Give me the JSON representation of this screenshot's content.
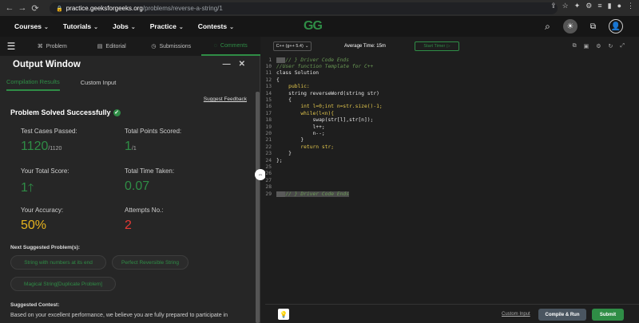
{
  "browser": {
    "url_host": "practice.geeksforgeeks.org",
    "url_path": "/problems/reverse-a-string/1"
  },
  "site_nav": {
    "logo": "GG",
    "menu": [
      "Courses",
      "Tutorials",
      "Jobs",
      "Practice",
      "Contests"
    ]
  },
  "tabs": {
    "problem": "Problem",
    "editorial": "Editorial",
    "submissions": "Submissions",
    "comments": "Comments"
  },
  "output_window": {
    "title": "Output Window",
    "tab_results": "Compilation Results",
    "tab_custom": "Custom Input",
    "suggest_feedback": "Suggest Feedback",
    "status": "Problem Solved Successfully",
    "stats": {
      "test_cases_label": "Test Cases Passed:",
      "test_cases_value": "1120",
      "test_cases_total": "/1120",
      "points_label": "Total Points Scored:",
      "points_value": "1",
      "points_total": "/1",
      "score_label": "Your Total Score:",
      "score_value": "1",
      "time_label": "Total Time Taken:",
      "time_value": "0.07",
      "accuracy_label": "Your Accuracy:",
      "accuracy_value": "50%",
      "attempts_label": "Attempts No.:",
      "attempts_value": "2"
    },
    "next_suggested_title": "Next Suggested Problem(s):",
    "suggestions": [
      "String with numbers at its end",
      "Perfect Reversible String",
      "Magical String[Duplicate Problem]"
    ],
    "contest_title": "Suggested Contest:",
    "contest_text": "Based on your excellent performance, we believe you are fully prepared to participate in"
  },
  "editor_toolbar": {
    "language": "C++ (g++ 5.4)",
    "avg_time": "Average Time: 15m",
    "start_timer": "Start Timer"
  },
  "code_lines": [
    {
      "n": "1",
      "text": "// } Driver Code Ends"
    },
    {
      "n": "10",
      "text": "//User function Template for C++"
    },
    {
      "n": "11",
      "text": "class Solution"
    },
    {
      "n": "12",
      "text": "{"
    },
    {
      "n": "13",
      "text": "    public:"
    },
    {
      "n": "14",
      "text": "    string reverseWord(string str)"
    },
    {
      "n": "15",
      "text": "    {"
    },
    {
      "n": "16",
      "text": "        int l=0;int n=str.size()-1;"
    },
    {
      "n": "17",
      "text": "        while(l<n){"
    },
    {
      "n": "18",
      "text": "            swap(str[l],str[n]);"
    },
    {
      "n": "19",
      "text": "            l++;"
    },
    {
      "n": "20",
      "text": "            n--;"
    },
    {
      "n": "21",
      "text": "        }"
    },
    {
      "n": "22",
      "text": "        return str;"
    },
    {
      "n": "23",
      "text": "    }"
    },
    {
      "n": "24",
      "text": "};"
    },
    {
      "n": "25",
      "text": ""
    },
    {
      "n": "26",
      "text": ""
    },
    {
      "n": "27",
      "text": ""
    },
    {
      "n": "28",
      "text": ""
    },
    {
      "n": "29",
      "text": "// } Driver Code Ends"
    }
  ],
  "editor_bottom": {
    "custom_input": "Custom Input",
    "compile_run": "Compile & Run",
    "submit": "Submit"
  },
  "colors": {
    "accent_green": "#2f8d46",
    "accuracy_yellow": "#e6b31e",
    "attempts_red": "#e53935"
  }
}
